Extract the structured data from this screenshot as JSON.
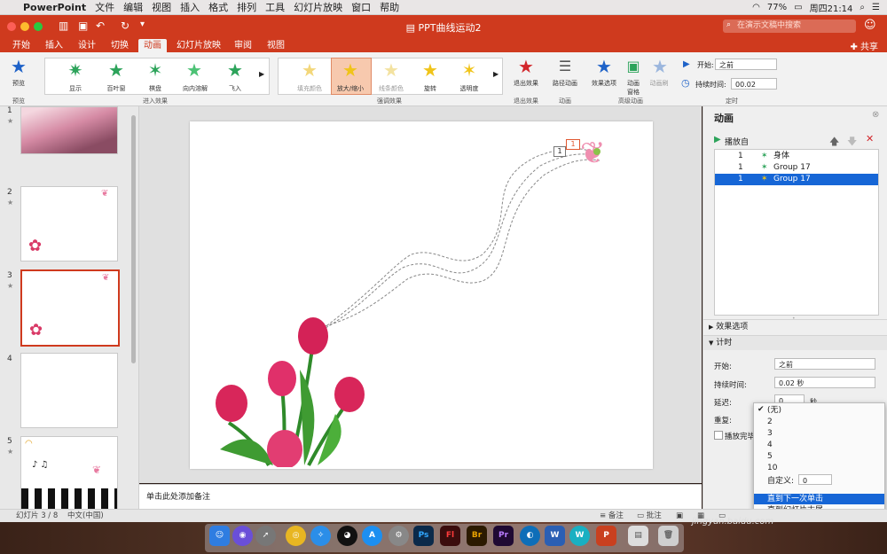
{
  "menubar": {
    "app": "PowerPoint",
    "items": [
      "文件",
      "编辑",
      "视图",
      "插入",
      "格式",
      "排列",
      "工具",
      "幻灯片放映",
      "窗口",
      "帮助"
    ],
    "battery": "77%",
    "datetime": "周四21:14"
  },
  "titlebar": {
    "title": "PPT曲线运动2",
    "search_placeholder": "在演示文稿中搜索"
  },
  "tabs": [
    "开始",
    "插入",
    "设计",
    "切换",
    "动画",
    "幻灯片放映",
    "审阅",
    "视图"
  ],
  "share": "共享",
  "ribbon": {
    "preview": "预览",
    "preview_group": "预览",
    "entrance": [
      "显示",
      "百叶窗",
      "棋盘",
      "向内溶解",
      "飞入"
    ],
    "entrance_group": "进入效果",
    "emphasis": [
      "填充颜色",
      "放大/缩小",
      "线条颜色",
      "旋转",
      "透明度"
    ],
    "emphasis_group": "强调效果",
    "exit": "退出效果",
    "exit_group": "退出效果",
    "path": "路径动画",
    "path_group": "动画",
    "effect_options": "效果选项",
    "animation_pane": "动画\n窗格",
    "anim_brush": "动画刷",
    "advanced_group": "高级动画",
    "start_label": "开始:",
    "start_value": "之前",
    "duration_label": "持续时间:",
    "duration_value": "00.02",
    "timing_group": "定时"
  },
  "slides": [
    {
      "num": "1"
    },
    {
      "num": "2"
    },
    {
      "num": "3"
    },
    {
      "num": "4"
    },
    {
      "num": "5"
    }
  ],
  "slide_badge": {
    "a": "1",
    "b": "1"
  },
  "notes_placeholder": "单击此处添加备注",
  "pane": {
    "title": "动画",
    "play_from": "播放自",
    "items": [
      {
        "order": "1",
        "name": "身体"
      },
      {
        "order": "1",
        "name": "Group 17"
      },
      {
        "order": "1",
        "name": "Group 17"
      }
    ],
    "effect_options": "效果选项",
    "timing": "计时",
    "start_label": "开始:",
    "start_value": "之前",
    "duration_label": "持续时间:",
    "duration_value": "0.02 秒",
    "delay_label": "延迟:",
    "delay_value": "0",
    "delay_unit": "秒",
    "repeat_label": "重复:",
    "rewind_label": "播放完毕"
  },
  "dropdown": {
    "items": [
      "(无)",
      "2",
      "3",
      "4",
      "5",
      "10"
    ],
    "custom_label": "自定义:",
    "custom_value": "0",
    "until_click": "直到下一次单击",
    "until_end": "直到幻灯片末尾"
  },
  "status": {
    "slide": "幻灯片 3 / 8",
    "lang": "中文(中国)",
    "notes": "备注",
    "comments": "批注"
  },
  "watermark": "jingyan.baidu.com",
  "colors": {
    "accent": "#cf3a1e",
    "selection": "#1666d6"
  }
}
